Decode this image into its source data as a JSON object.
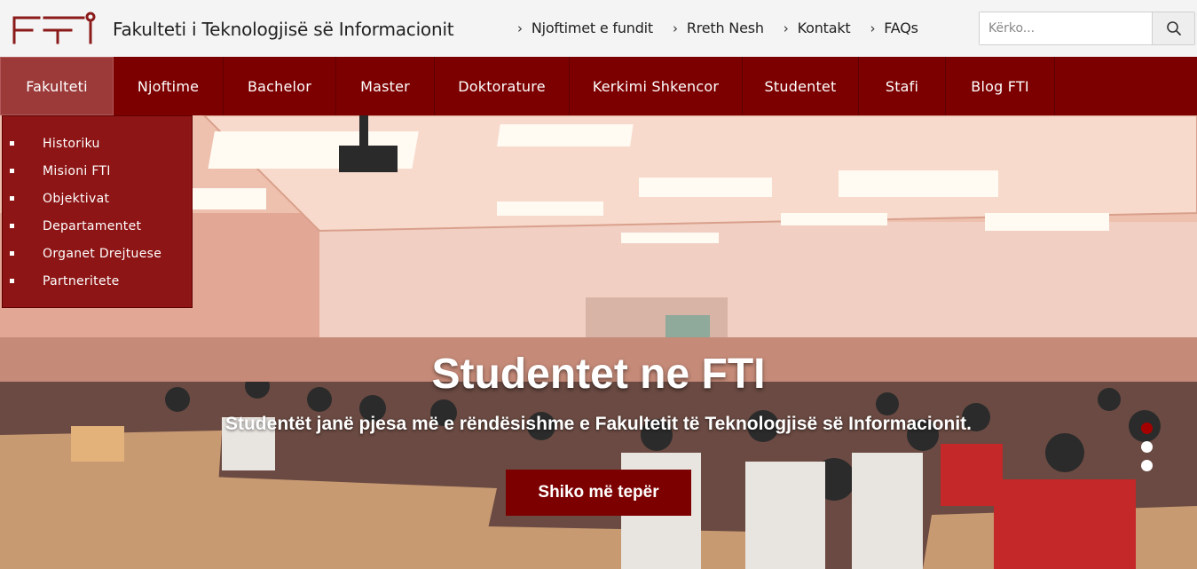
{
  "header": {
    "title": "Fakulteti i Teknologjisë së Informacionit",
    "links": [
      {
        "label": "Njoftimet e fundit"
      },
      {
        "label": "Rreth Nesh"
      },
      {
        "label": "Kontakt"
      },
      {
        "label": "FAQs"
      }
    ],
    "search": {
      "placeholder": "Kërko..."
    }
  },
  "nav": {
    "items": [
      {
        "label": "Fakulteti"
      },
      {
        "label": "Njoftime"
      },
      {
        "label": "Bachelor"
      },
      {
        "label": "Master"
      },
      {
        "label": "Doktorature"
      },
      {
        "label": "Kerkimi Shkencor"
      },
      {
        "label": "Studentet"
      },
      {
        "label": "Stafi"
      },
      {
        "label": "Blog FTI"
      }
    ]
  },
  "dropdown": {
    "items": [
      {
        "label": "Historiku"
      },
      {
        "label": "Misioni FTI"
      },
      {
        "label": "Objektivat"
      },
      {
        "label": "Departamentet"
      },
      {
        "label": "Organet Drejtuese"
      },
      {
        "label": "Partneritete"
      }
    ]
  },
  "hero": {
    "title": "Studentet ne FTI",
    "subtitle": "Studentët janë pjesa më e rëndësishme e Fakultetit të Teknologjisë së Informacionit.",
    "button_label": "Shiko më tepër",
    "slide_count": 3,
    "active_slide": 1
  },
  "colors": {
    "brand": "#7d0000",
    "active_nav": "#9c3a3a",
    "dropdown": "#8e1515"
  }
}
